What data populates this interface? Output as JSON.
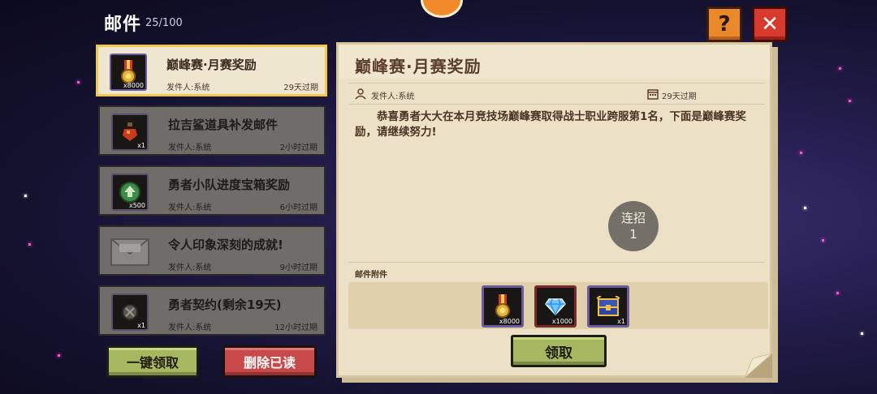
{
  "header": {
    "title": "邮件",
    "count": "25/100"
  },
  "buttons": {
    "help": "?",
    "close": "✕",
    "claim_all": "一键领取",
    "delete_read": "删除已读",
    "claim": "领取"
  },
  "mails": [
    {
      "title": "巅峰赛·月赛奖励",
      "sender": "发件人:系统",
      "expire": "29天过期",
      "qty": "x8000",
      "icon": "medal-icon",
      "active": true
    },
    {
      "title": "拉吉鲨道具补发邮件",
      "sender": "发件人:系统",
      "expire": "2小时过期",
      "qty": "x1",
      "icon": "potion-icon",
      "active": false
    },
    {
      "title": "勇者小队进度宝箱奖励",
      "sender": "发件人:系统",
      "expire": "6小时过期",
      "qty": "x500",
      "icon": "gem-token-icon",
      "active": false
    },
    {
      "title": "令人印象深刻的成就!",
      "sender": "发件人:系统",
      "expire": "9小时过期",
      "qty": "",
      "icon": "envelope-icon",
      "active": false
    },
    {
      "title": "勇者契约(剩余19天)",
      "sender": "发件人:系统",
      "expire": "12小时过期",
      "qty": "x1",
      "icon": "contract-coin-icon",
      "active": false
    }
  ],
  "detail": {
    "title": "巅峰赛·月赛奖励",
    "sender": "发件人:系统",
    "expire": "29天过期",
    "body": "恭喜勇者大大在本月竞技场巅峰赛取得战士职业跨服第1名，下面是巅峰赛奖励，请继续努力!",
    "attachments_label": "邮件附件",
    "attachments": [
      {
        "icon": "medal-icon",
        "qty": "x8000"
      },
      {
        "icon": "diamond-icon",
        "qty": "x1000"
      },
      {
        "icon": "treasure-chest-icon",
        "qty": "x1"
      }
    ]
  },
  "combo": {
    "label": "连招",
    "value": "1"
  }
}
